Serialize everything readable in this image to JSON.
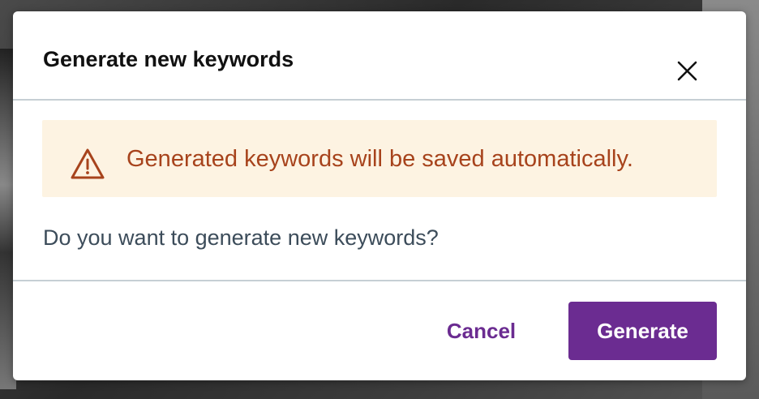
{
  "dialog": {
    "title": "Generate new keywords",
    "close_icon": "close-icon",
    "alert": {
      "icon": "warning-icon",
      "message": "Generated keywords will be saved automatically."
    },
    "question": "Do you want to generate new keywords?",
    "buttons": {
      "cancel_label": "Cancel",
      "generate_label": "Generate"
    }
  },
  "colors": {
    "primary": "#6b2c91",
    "alert_background": "#fdf3e2",
    "alert_text": "#a7431c",
    "body_text": "#3c4c5a"
  }
}
